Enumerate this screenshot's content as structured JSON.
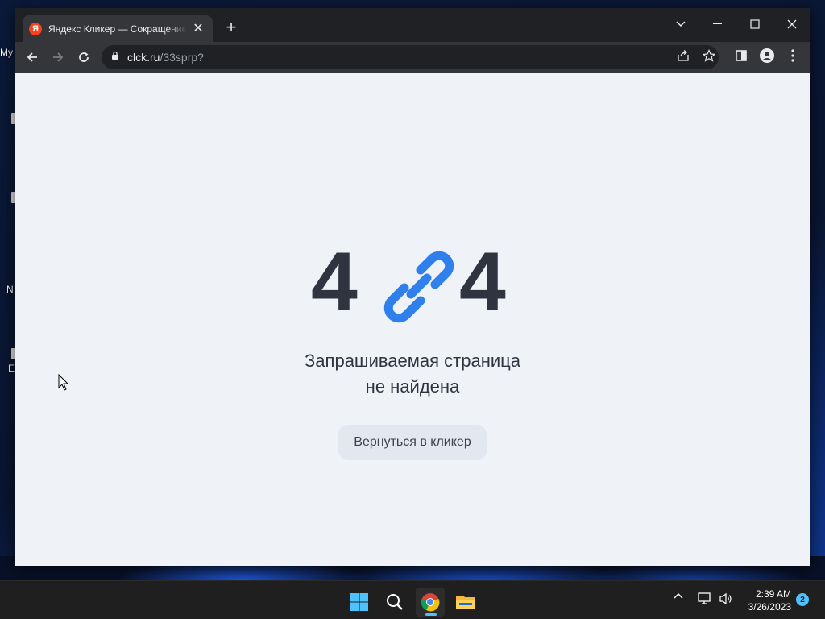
{
  "desktop": {
    "labels": [
      "My",
      "N",
      "E"
    ]
  },
  "browser": {
    "tab": {
      "favicon_letter": "Я",
      "title": "Яндекс Кликер — Сокращение"
    },
    "address_bar": {
      "host": "clck.ru",
      "path": "/33sprp?"
    }
  },
  "page": {
    "error_code_left": "4",
    "error_code_right": "4",
    "message_line1": "Запрашиваемая страница",
    "message_line2": "не найдена",
    "back_button_label": "Вернуться в кликер",
    "accent_color": "#2f80ed"
  },
  "taskbar": {
    "time": "2:39 AM",
    "date": "3/26/2023",
    "notification_count": "2"
  }
}
